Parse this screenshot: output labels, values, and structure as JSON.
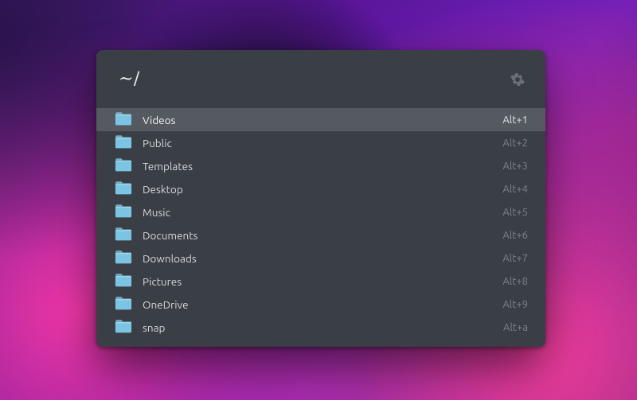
{
  "header": {
    "prompt": "~/"
  },
  "folder_icon_color": "#7bc4e3",
  "items": [
    {
      "label": "Videos",
      "shortcut": "Alt+1",
      "selected": true
    },
    {
      "label": "Public",
      "shortcut": "Alt+2",
      "selected": false
    },
    {
      "label": "Templates",
      "shortcut": "Alt+3",
      "selected": false
    },
    {
      "label": "Desktop",
      "shortcut": "Alt+4",
      "selected": false
    },
    {
      "label": "Music",
      "shortcut": "Alt+5",
      "selected": false
    },
    {
      "label": "Documents",
      "shortcut": "Alt+6",
      "selected": false
    },
    {
      "label": "Downloads",
      "shortcut": "Alt+7",
      "selected": false
    },
    {
      "label": "Pictures",
      "shortcut": "Alt+8",
      "selected": false
    },
    {
      "label": "OneDrive",
      "shortcut": "Alt+9",
      "selected": false
    },
    {
      "label": "snap",
      "shortcut": "Alt+a",
      "selected": false
    }
  ]
}
